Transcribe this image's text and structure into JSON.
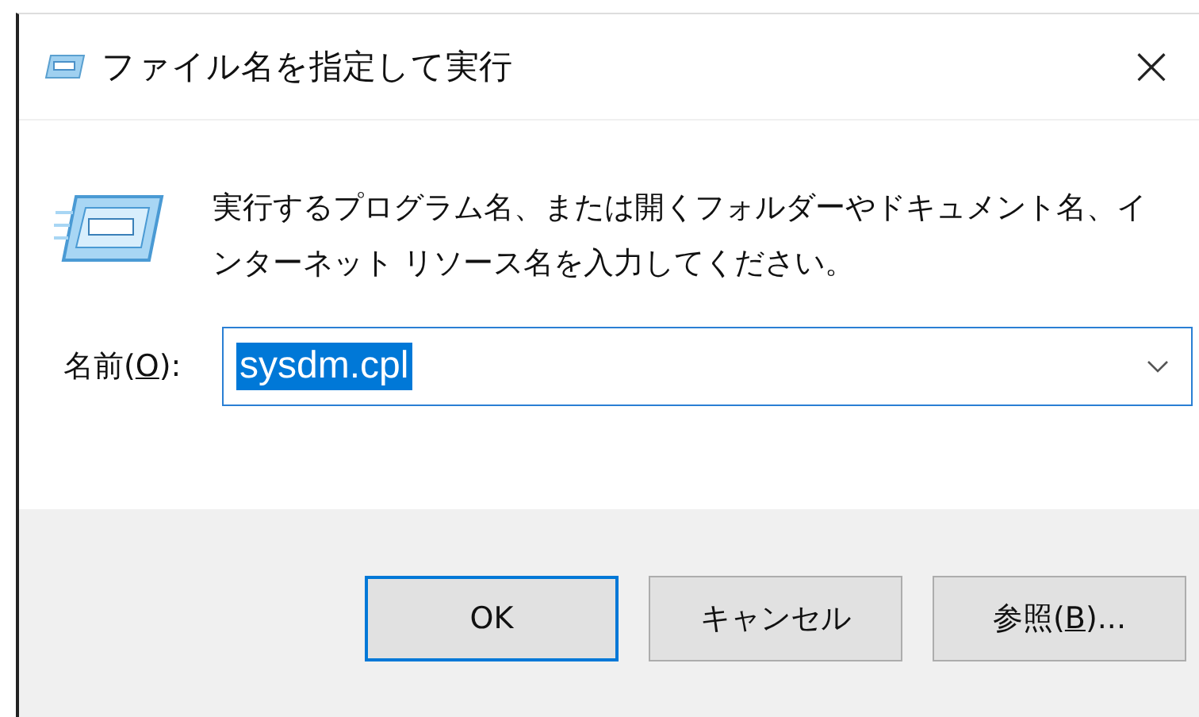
{
  "window": {
    "title": "ファイル名を指定して実行",
    "close": "×"
  },
  "description": [
    "実行するプログラム名、または開くフォルダーやドキュメント名、イ",
    "ンターネット リソース名を入力してください。"
  ],
  "name_field": {
    "label_before": "名前(",
    "access_key": "O",
    "label_after": "):",
    "value": "sysdm.cpl",
    "text_selected": true
  },
  "buttons": [
    {
      "label_before": "OK",
      "default": true
    },
    {
      "label_before": "キャンセル",
      "default": false
    },
    {
      "label_before": "参照(",
      "access_key": "B",
      "label_after": ")...",
      "default": false
    }
  ]
}
